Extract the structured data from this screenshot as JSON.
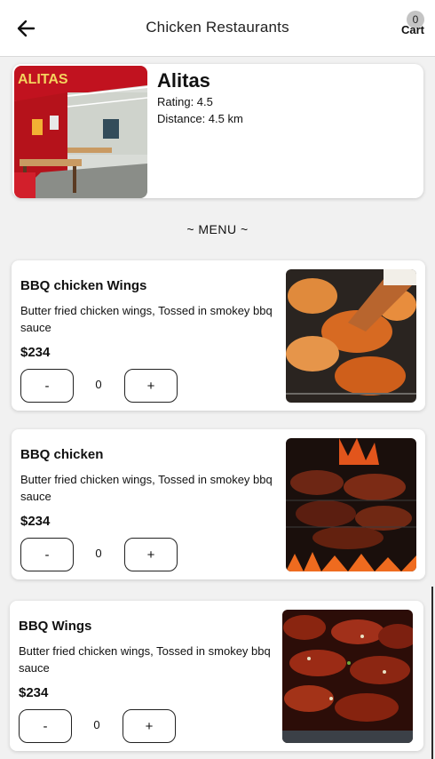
{
  "header": {
    "back_icon": "arrow-left-icon",
    "title": "Chicken Restaurants",
    "cart_label": "Cart",
    "cart_count": "0"
  },
  "restaurant": {
    "name": "Alitas",
    "rating": "Rating: 4.5",
    "distance": "Distance: 4.5 km"
  },
  "menu_heading": "~ MENU ~",
  "menu_items": [
    {
      "name": "BBQ chicken Wings",
      "description": "Butter fried chicken wings, Tossed in smokey bbq sauce",
      "price": "$234",
      "quantity": "0",
      "minus_label": "-",
      "plus_label": "+"
    },
    {
      "name": "BBQ chicken",
      "description": "Butter fried chicken wings, Tossed in smokey bbq sauce",
      "price": "$234",
      "quantity": "0",
      "minus_label": "-",
      "plus_label": "+"
    },
    {
      "name": "BBQ Wings",
      "description": "Butter fried chicken wings, Tossed in smokey bbq sauce",
      "price": "$234",
      "quantity": "0",
      "minus_label": "-",
      "plus_label": "+"
    }
  ],
  "colors": {
    "background": "#f1f1f1",
    "card": "#ffffff",
    "text": "#111111"
  }
}
